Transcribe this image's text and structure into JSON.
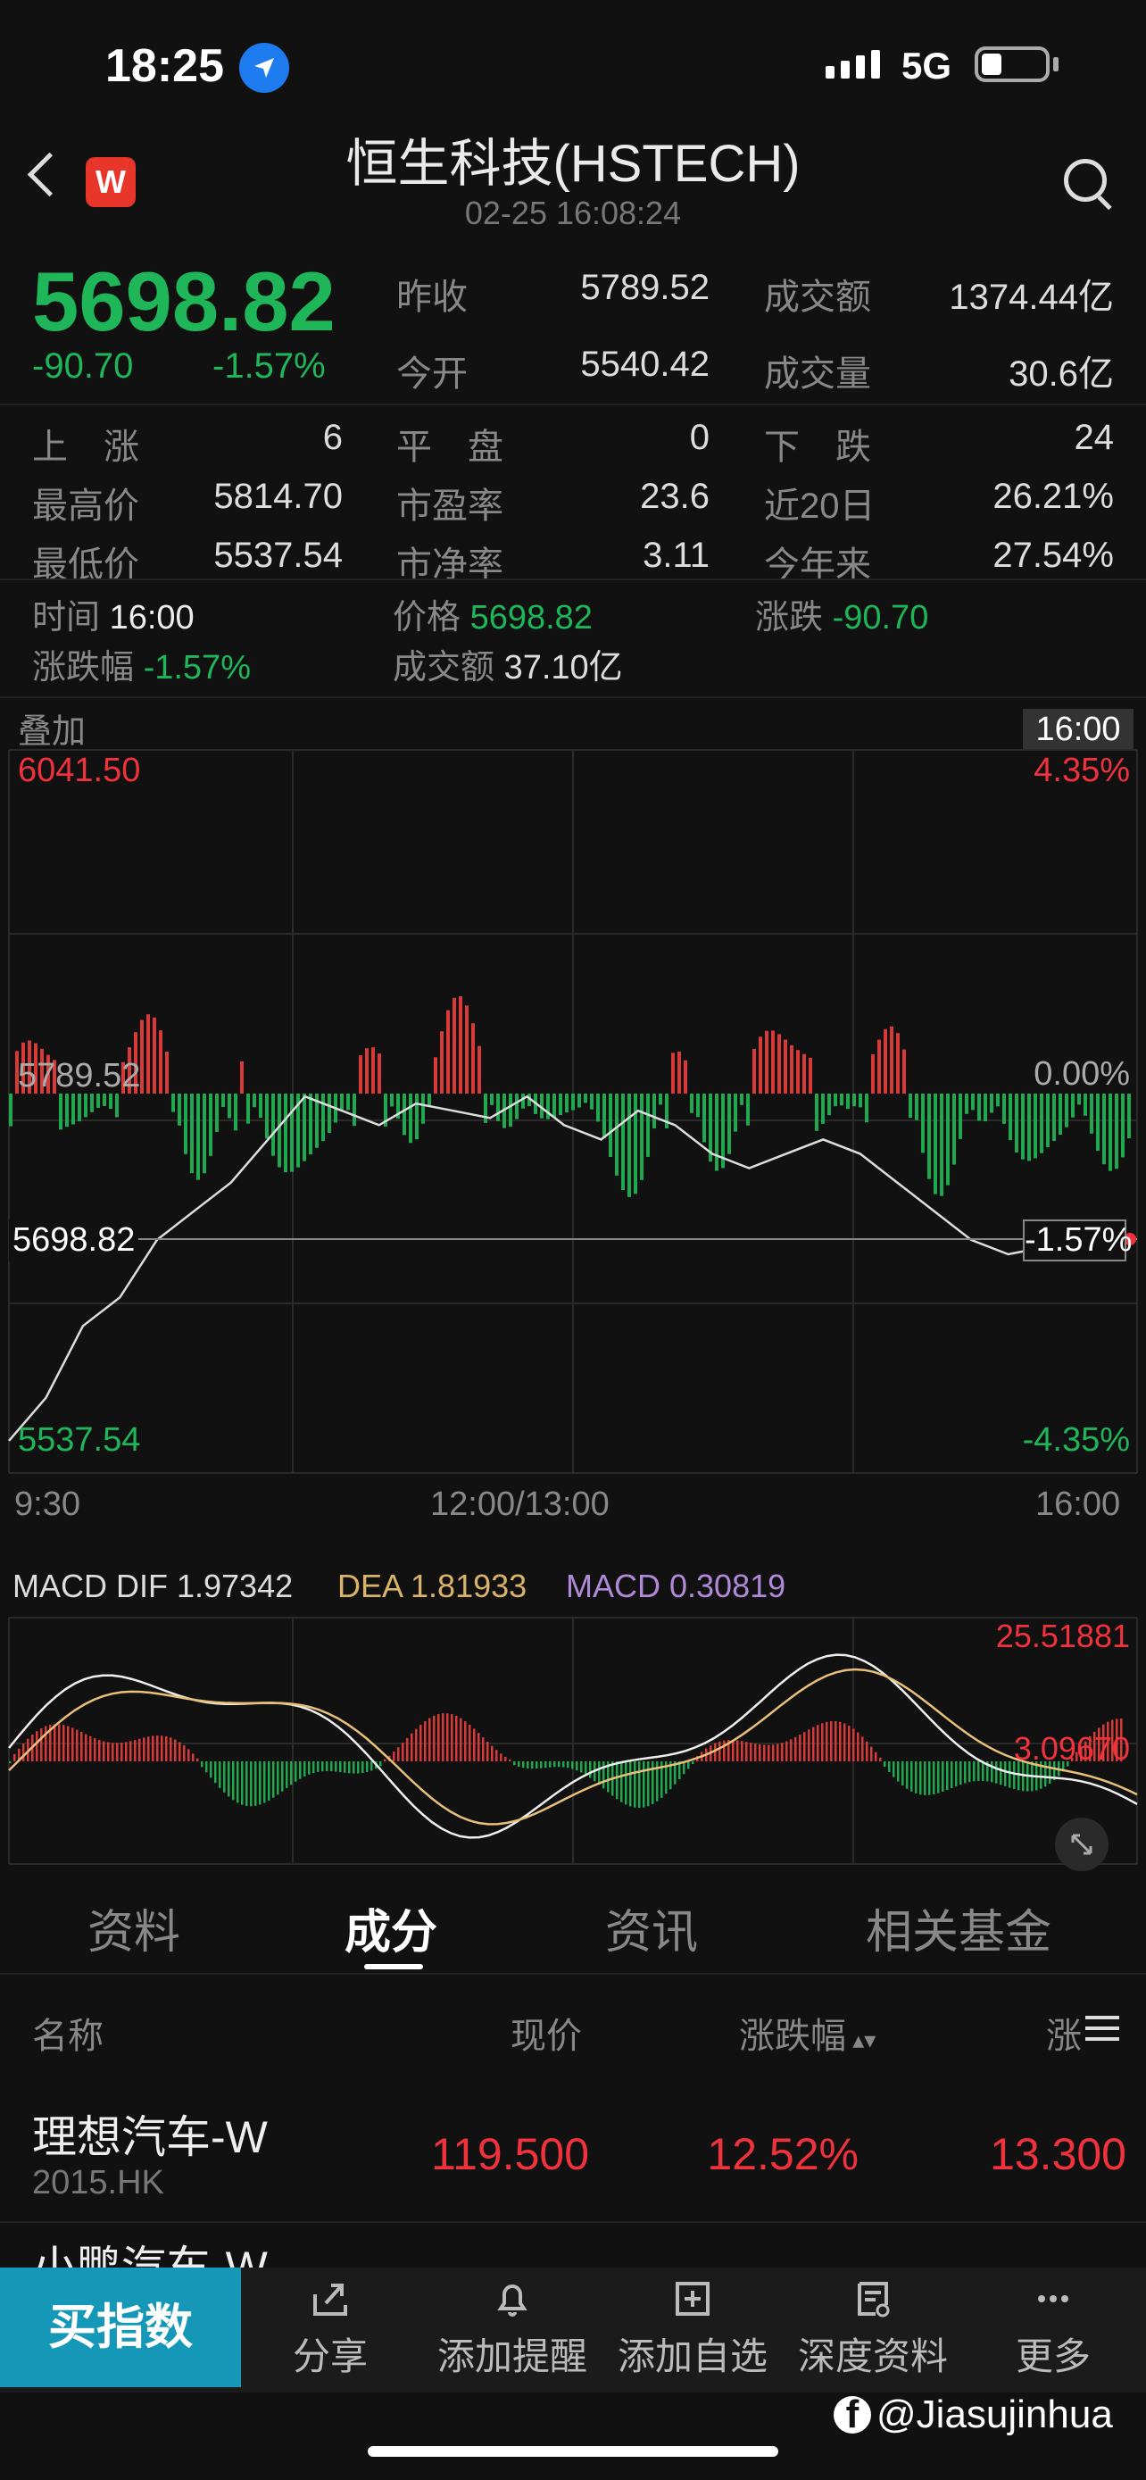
{
  "status_bar": {
    "time": "18:25",
    "network": "5G"
  },
  "header": {
    "title": "恒生科技(HSTECH)",
    "subtitle": "02-25 16:08:24",
    "badge": "W"
  },
  "quote": {
    "price": "5698.82",
    "change": "-90.70",
    "change_pct": "-1.57%",
    "stats": [
      {
        "label": "昨收",
        "value": "5789.52"
      },
      {
        "label": "成交额",
        "value": "1374.44亿"
      },
      {
        "label": "今开",
        "value": "5540.42"
      },
      {
        "label": "成交量",
        "value": "30.6亿"
      }
    ],
    "grid": [
      {
        "label": "上　涨",
        "value": "6"
      },
      {
        "label": "平　盘",
        "value": "0"
      },
      {
        "label": "下　跌",
        "value": "24"
      },
      {
        "label": "最高价",
        "value": "5814.70"
      },
      {
        "label": "市盈率",
        "value": "23.6"
      },
      {
        "label": "近20日",
        "value": "26.21%"
      },
      {
        "label": "最低价",
        "value": "5537.54"
      },
      {
        "label": "市净率",
        "value": "3.11"
      },
      {
        "label": "今年来",
        "value": "27.54%"
      }
    ]
  },
  "crosshair": {
    "time_label": "时间",
    "time": "16:00",
    "price_label": "价格",
    "price": "5698.82",
    "chg_label": "涨跌",
    "chg": "-90.70",
    "pct_label": "涨跌幅",
    "pct": "-1.57%",
    "amt_label": "成交额",
    "amt": "37.10亿"
  },
  "chart": {
    "overlay_label": "叠加",
    "time_tag": "16:00",
    "y_left": {
      "top": "6041.50",
      "mid": "5789.52",
      "cur": "5698.82",
      "bottom": "5537.54"
    },
    "y_right": {
      "top": "4.35%",
      "mid": "0.00%",
      "cur": "-1.57%",
      "bottom": "-4.35%"
    },
    "x_labels": [
      "9:30",
      "12:00/13:00",
      "16:00"
    ]
  },
  "chart_data": {
    "type": "line",
    "series": [
      {
        "name": "",
        "values": [
          5560,
          5590,
          5640,
          5660,
          5700,
          5720,
          5740,
          5770,
          5800,
          5790,
          5780,
          5795,
          5790,
          5785,
          5800,
          5780,
          5770,
          5790,
          5780,
          5760,
          5750,
          5760,
          5770,
          5760,
          5740,
          5720,
          5700,
          5690,
          5695,
          5705,
          5700
        ]
      }
    ],
    "ylim": [
      5537.54,
      6041.5
    ],
    "ticks_left": [
      "6041.50",
      "5789.52",
      "5698.82",
      "5537.54"
    ],
    "ticks_right": [
      "4.35%",
      "0.00%",
      "-1.57%",
      "-4.35%"
    ]
  },
  "macd": {
    "dif_label": "MACD DIF 1.97342",
    "dea_label": "DEA 1.81933",
    "macd_label": "MACD 0.30819",
    "top": "25.51881",
    "cur": "3.09670"
  },
  "tabs": [
    "资料",
    "成分",
    "资讯",
    "相关基金"
  ],
  "table": {
    "headers": [
      "名称",
      "现价",
      "涨跌幅",
      "涨"
    ],
    "rows": [
      {
        "name": "理想汽车-W",
        "code": "2015.HK",
        "price": "119.500",
        "pct": "12.52%",
        "chg": "13.300"
      },
      {
        "name": "小鹏汽车-W",
        "code": "",
        "price": "",
        "pct": "",
        "chg": ""
      }
    ]
  },
  "bottom": {
    "buy": "买指数",
    "actions": [
      "分享",
      "添加提醒",
      "添加自选",
      "深度资料",
      "更多"
    ]
  },
  "watermark": "@Jiasujinhua"
}
